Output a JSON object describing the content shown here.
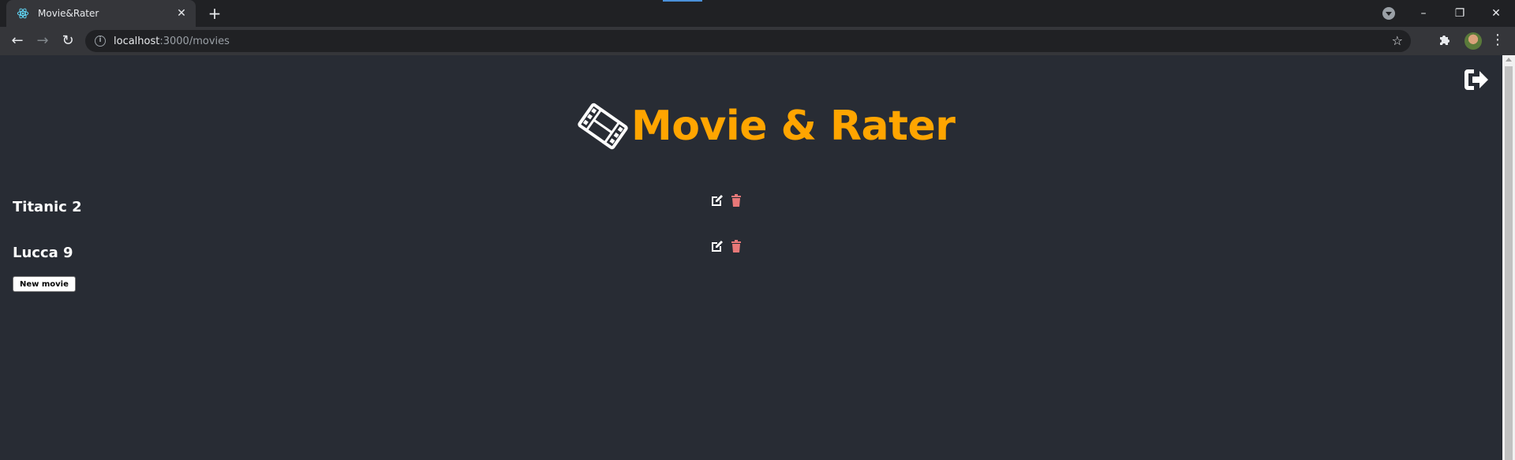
{
  "browser": {
    "tab_title": "Movie&Rater",
    "url_host": "localhost",
    "url_path": ":3000/movies"
  },
  "app": {
    "title": "Movie & Rater",
    "accent_color": "#ffa500",
    "delete_color": "#e87878",
    "background": "#282c34"
  },
  "movies": [
    {
      "title": "Titanic 2"
    },
    {
      "title": "Lucca 9"
    }
  ],
  "actions": {
    "new_movie_label": "New movie"
  },
  "icons": {
    "favicon": "react-icon",
    "logout": "sign-out-icon",
    "header": "film-icon",
    "edit": "edit-icon",
    "delete": "trash-icon"
  }
}
